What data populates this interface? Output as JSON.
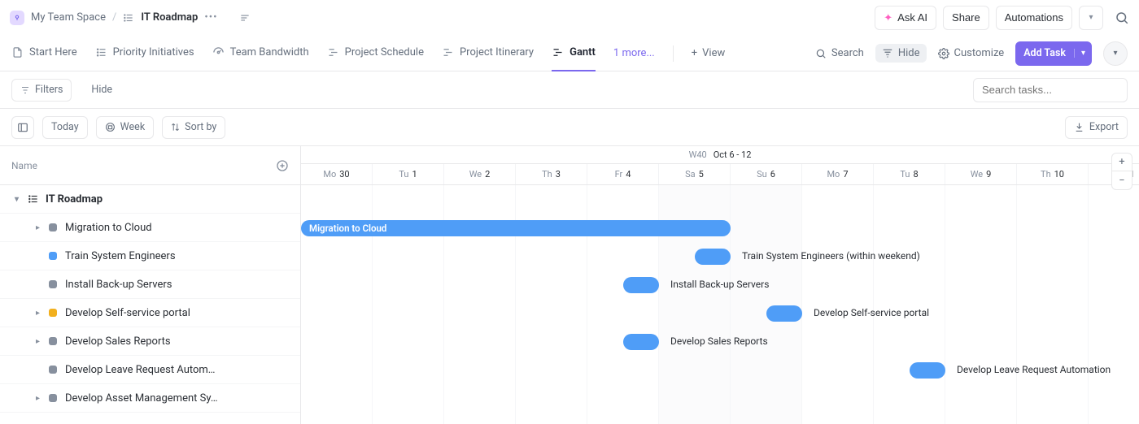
{
  "breadcrumb": {
    "space": "My Team Space",
    "list": "IT Roadmap"
  },
  "header_actions": {
    "ask_ai": "Ask AI",
    "share": "Share",
    "automations": "Automations"
  },
  "views": [
    {
      "icon": "doc",
      "label": "Start Here"
    },
    {
      "icon": "list-ordered",
      "label": "Priority Initiatives"
    },
    {
      "icon": "gauge",
      "label": "Team Bandwidth"
    },
    {
      "icon": "gantt",
      "label": "Project Schedule"
    },
    {
      "icon": "gantt",
      "label": "Project Itinerary"
    },
    {
      "icon": "gantt",
      "label": "Gantt",
      "active": true
    }
  ],
  "views_more": "1 more...",
  "views_add": "View",
  "views_right": {
    "search": "Search",
    "hide": "Hide",
    "customize": "Customize",
    "add_task": "Add Task"
  },
  "filters": {
    "filters": "Filters",
    "hide": "Hide",
    "search_placeholder": "Search tasks..."
  },
  "toolbar": {
    "today": "Today",
    "week": "Week",
    "sort": "Sort by",
    "export": "Export"
  },
  "side": {
    "header": "Name",
    "group": "IT Roadmap",
    "items": [
      {
        "label": "Migration to Cloud",
        "color": "#87909e",
        "caret": true
      },
      {
        "label": "Train System Engineers",
        "color": "#4f9df7",
        "caret": false
      },
      {
        "label": "Install Back-up Servers",
        "color": "#87909e",
        "caret": false
      },
      {
        "label": "Develop Self-service portal",
        "color": "#f2b01e",
        "caret": true
      },
      {
        "label": "Develop Sales Reports",
        "color": "#87909e",
        "caret": true
      },
      {
        "label": "Develop Leave Request Autom…",
        "color": "#87909e",
        "caret": false
      },
      {
        "label": "Develop Asset Management Sy…",
        "color": "#87909e",
        "caret": true
      }
    ]
  },
  "timeline": {
    "week_label": "W40",
    "range_label": "Oct 6 - 12",
    "days": [
      {
        "dow": "Mo",
        "num": "30"
      },
      {
        "dow": "Tu",
        "num": "1"
      },
      {
        "dow": "We",
        "num": "2"
      },
      {
        "dow": "Th",
        "num": "3"
      },
      {
        "dow": "Fr",
        "num": "4"
      },
      {
        "dow": "Sa",
        "num": "5"
      },
      {
        "dow": "Su",
        "num": "6"
      },
      {
        "dow": "Mo",
        "num": "7"
      },
      {
        "dow": "Tu",
        "num": "8"
      },
      {
        "dow": "We",
        "num": "9"
      },
      {
        "dow": "Th",
        "num": "10"
      },
      {
        "dow": "Fr",
        "num": "11"
      }
    ],
    "weekend_cols": [
      5,
      6
    ],
    "bars": [
      {
        "row": 0,
        "start": 0,
        "span": 6.0,
        "text": "Migration to Cloud",
        "side_label": ""
      },
      {
        "row": 1,
        "start": 5.5,
        "span": 0.5,
        "text": "",
        "side_label": "Train System Engineers (within weekend)"
      },
      {
        "row": 2,
        "start": 4.5,
        "span": 0.5,
        "text": "",
        "side_label": "Install Back-up Servers"
      },
      {
        "row": 3,
        "start": 6.5,
        "span": 0.5,
        "text": "",
        "side_label": "Develop Self-service portal"
      },
      {
        "row": 4,
        "start": 4.5,
        "span": 0.5,
        "text": "",
        "side_label": "Develop Sales Reports"
      },
      {
        "row": 5,
        "start": 8.5,
        "span": 0.5,
        "text": "",
        "side_label": "Develop Leave Request Automation"
      }
    ]
  }
}
